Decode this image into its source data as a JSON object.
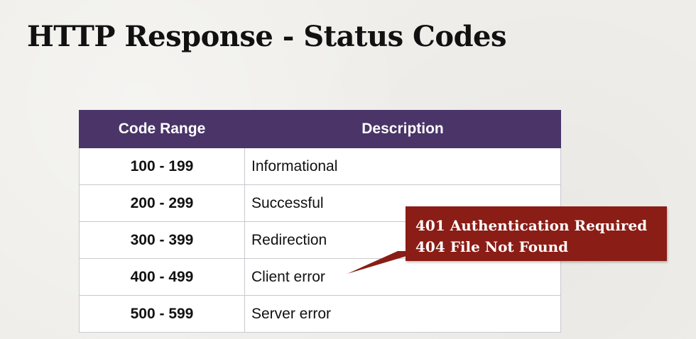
{
  "slide": {
    "title": "HTTP Response - Status Codes"
  },
  "table": {
    "headers": [
      "Code Range",
      "Description"
    ],
    "rows": [
      {
        "code": "100 - 199",
        "description": "Informational"
      },
      {
        "code": "200 - 299",
        "description": "Successful"
      },
      {
        "code": "300 - 399",
        "description": "Redirection"
      },
      {
        "code": "400 - 499",
        "description": "Client error"
      },
      {
        "code": "500 - 599",
        "description": "Server error"
      }
    ]
  },
  "callout": {
    "lines": [
      "401 Authentication Required",
      "404 File Not Found"
    ],
    "color": "#8a1d16"
  },
  "colors": {
    "header_background": "#4a3468",
    "background": "#efeeea"
  }
}
